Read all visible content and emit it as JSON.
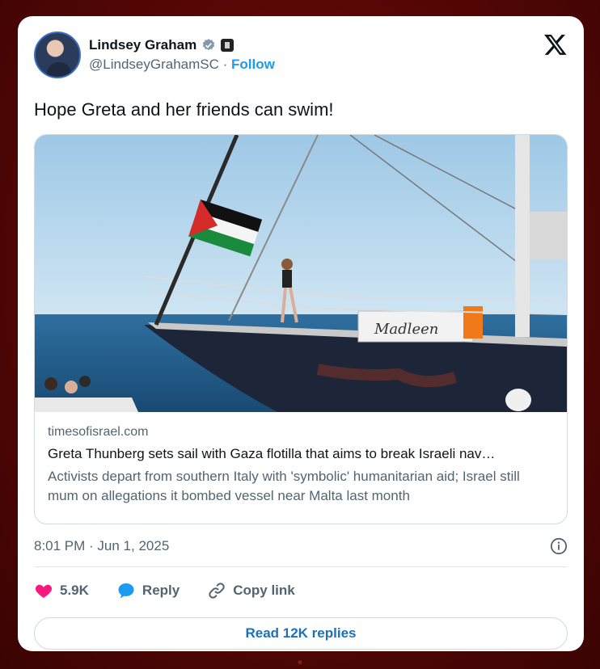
{
  "tweet": {
    "author_name": "Lindsey Graham",
    "handle": "@LindseyGrahamSC",
    "separator": "·",
    "follow_label": "Follow",
    "text": "Hope Greta and her friends can swim!",
    "timestamp": "8:01 PM · Jun 1, 2025"
  },
  "link_card": {
    "domain": "timesofisrael.com",
    "title": "Greta Thunberg sets sail with Gaza flotilla that aims to break Israeli nav…",
    "description": "Activists depart from southern Italy with 'symbolic' humanitarian aid; Israel still mum on allegations it bombed vessel near Malta last month",
    "photo_boat_name": "Madleen"
  },
  "actions": {
    "likes": "5.9K",
    "reply_label": "Reply",
    "copy_link_label": "Copy link",
    "read_replies_label": "Read 12K replies"
  },
  "colors": {
    "accent": "#1d9bf0",
    "like": "#f91880",
    "background": "#5a0705"
  },
  "icons": {
    "verified": "verified-badge-icon",
    "government": "government-badge-icon",
    "x_logo": "x-logo-icon",
    "info": "info-icon",
    "like": "heart-icon",
    "reply": "reply-bubble-icon",
    "copy_link": "link-icon"
  }
}
